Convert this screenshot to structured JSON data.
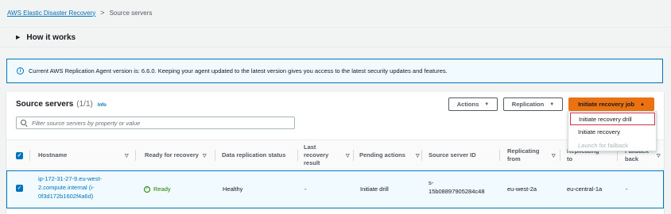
{
  "breadcrumb": {
    "root": "AWS Elastic Disaster Recovery",
    "separator": ">",
    "current": "Source servers"
  },
  "how_it_works": {
    "label": "How it works"
  },
  "alert": {
    "icon": "info-icon",
    "text": "Current AWS Replication Agent version is: 6.6.0. Keeping your agent updated to the latest version gives you access to the latest security updates and features."
  },
  "panel": {
    "title": "Source servers",
    "count": "(1/1)",
    "info": "Info",
    "actions_label": "Actions",
    "replication_label": "Replication",
    "initiate_label": "Initiate recovery job",
    "search_placeholder": "Filter source servers by property or value"
  },
  "table": {
    "headers": [
      {
        "key": "hostname",
        "label": "Hostname"
      },
      {
        "key": "ready",
        "label": "Ready for recovery"
      },
      {
        "key": "status",
        "label": "Data replication status"
      },
      {
        "key": "last_recovery",
        "line1": "Last",
        "line2": "recovery",
        "line3": "result"
      },
      {
        "key": "pending",
        "label": "Pending actions"
      },
      {
        "key": "server_id",
        "label": "Source server ID"
      },
      {
        "key": "repl_from",
        "line1": "Replicating",
        "line2": "from"
      },
      {
        "key": "repl_to",
        "line1": "Replicating",
        "line2": "to"
      },
      {
        "key": "failback",
        "line1": "Failback",
        "line2": "back"
      }
    ],
    "row": {
      "hostname_l1": "ip-172-31-27-9.eu-west-",
      "hostname_l2": "2.compute.internal (i-",
      "hostname_l3": "0f3d172b1602f4a6d)",
      "ready": "Ready",
      "status": "Healthy",
      "last_recovery": "-",
      "pending": "Initiate drill",
      "server_id_l1": "s-",
      "server_id_l2": "15b08897905284c48",
      "repl_from": "eu-west-2a",
      "repl_to": "eu-central-1a",
      "failback": "-"
    }
  },
  "dropdown": {
    "items": [
      {
        "label": "Initiate recovery drill",
        "state": "highlighted"
      },
      {
        "label": "Initiate recovery",
        "state": "enabled"
      },
      {
        "label": "Launch for failback",
        "state": "disabled"
      }
    ]
  },
  "colors": {
    "link": "#0073bb",
    "primary": "#ec7211",
    "success": "#1d8102",
    "highlight_border": "#c7384b"
  }
}
